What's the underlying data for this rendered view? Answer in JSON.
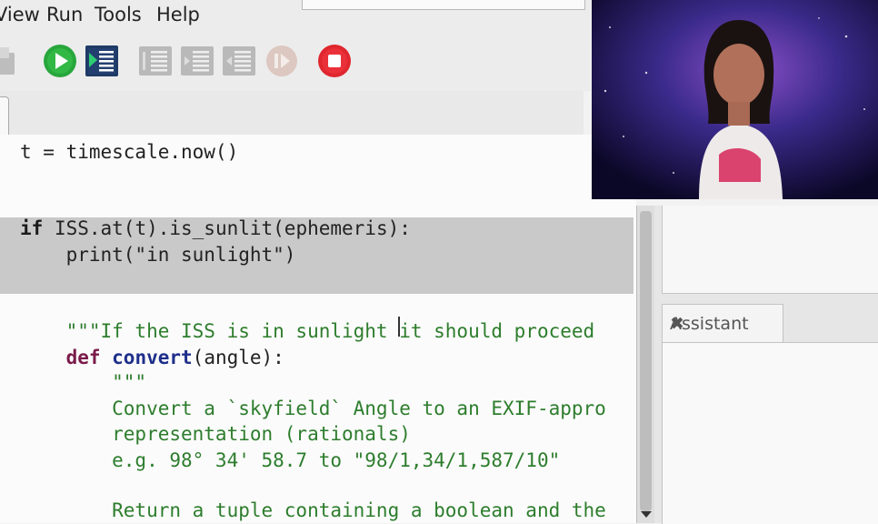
{
  "menu": {
    "view": "View",
    "run": "Run",
    "tools": "Tools",
    "help": "Help"
  },
  "toolbar": {
    "icons": [
      "save-icon",
      "run-icon",
      "debug-icon",
      "step-over-icon",
      "step-into-icon",
      "step-out-icon",
      "resume-icon",
      "stop-icon"
    ],
    "colors": {
      "run": "#27a63c",
      "stop": "#e0262e",
      "debug": "#1d3b66",
      "disabled": "#b9b9b9"
    }
  },
  "code": {
    "line1": "t = timescale.now()",
    "line2_kw": "if",
    "line2_rest": " ISS.at(t).is_sunlit(ephemeris):",
    "line3": "    print(\"in sunlight\")",
    "line4_str": "    \"\"\"If the ISS is in sunlight it should proceed",
    "line5_kw": "    def",
    "line5_fn": " convert",
    "line5_rest": "(angle):",
    "line6": "        \"\"\"",
    "line7": "        Convert a `skyfield` Angle to an EXIF-appro",
    "line8": "        representation (rationals)",
    "line9": "        e.g. 98° 34' 58.7 to \"98/1,34/1,587/10\"",
    "line10": "        Return a tuple containing a boolean and the"
  },
  "assistant": {
    "tab_label": "Assistant",
    "close": "✖"
  }
}
